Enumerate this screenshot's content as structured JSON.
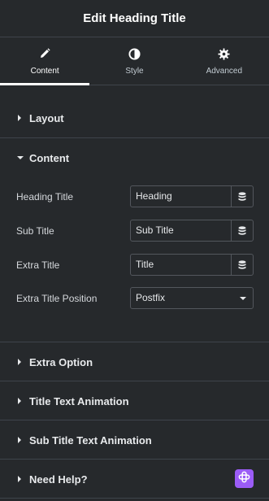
{
  "header": {
    "title": "Edit Heading Title"
  },
  "tabs": [
    {
      "label": "Content",
      "icon": "pencil-icon",
      "active": true
    },
    {
      "label": "Style",
      "icon": "contrast-icon",
      "active": false
    },
    {
      "label": "Advanced",
      "icon": "gear-icon",
      "active": false
    }
  ],
  "sections": {
    "layout": "Layout",
    "content": "Content",
    "extra_option": "Extra Option",
    "title_text_animation": "Title Text Animation",
    "sub_title_text_animation": "Sub Title Text Animation",
    "need_help": "Need Help?"
  },
  "fields": {
    "heading_title": {
      "label": "Heading Title",
      "value": "Heading"
    },
    "sub_title": {
      "label": "Sub Title",
      "value": "Sub Title"
    },
    "extra_title": {
      "label": "Extra Title",
      "value": "Title"
    },
    "extra_title_position": {
      "label": "Extra Title Position",
      "value": "Postfix"
    }
  },
  "colors": {
    "background": "#26292c",
    "divider": "#3f444b",
    "help_badge": "#9b5cf6"
  }
}
